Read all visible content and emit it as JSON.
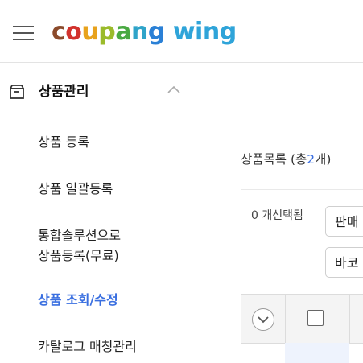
{
  "header": {
    "logo_parts": [
      {
        "text": "c",
        "color": "#8b4a2b"
      },
      {
        "text": "o",
        "color": "#d2322d"
      },
      {
        "text": "u",
        "color": "#e8a21c"
      },
      {
        "text": "p",
        "color": "#9bbb2b"
      },
      {
        "text": "a",
        "color": "#49a942"
      },
      {
        "text": "n",
        "color": "#2fa4c9"
      },
      {
        "text": "g",
        "color": "#2a80d6"
      },
      {
        "text": " ",
        "color": "#ffffff"
      },
      {
        "text": "w",
        "color": "#2fa4d9"
      },
      {
        "text": "i",
        "color": "#2fa4d9"
      },
      {
        "text": "n",
        "color": "#2fa4d9"
      },
      {
        "text": "g",
        "color": "#2fa4d9"
      }
    ],
    "menu_icon": "hamburger-icon"
  },
  "sidebar": {
    "section_title": "상품관리",
    "section_icon": "box-icon",
    "items": [
      {
        "label": "상품 등록"
      },
      {
        "label": "상품 일괄등록"
      },
      {
        "label": "통합솔루션으로"
      },
      {
        "label": "상품등록(무료)"
      },
      {
        "label": "상품 조회/수정"
      },
      {
        "label": "카탈로그 매칭관리"
      }
    ]
  },
  "main": {
    "list_title_prefix": "상품목록 (총",
    "list_count": "2",
    "list_title_suffix": "개)",
    "selected_text": "0 개선택됨",
    "button_sell": "판매",
    "button_barcode": "바코"
  },
  "colors": {
    "accent": "#3a6fe0"
  }
}
